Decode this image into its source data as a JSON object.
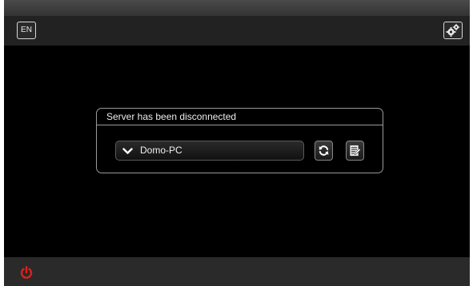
{
  "header": {
    "language_label": "EN",
    "settings_icon": "gears-icon"
  },
  "dialog": {
    "title": "Server has been disconnected",
    "server_select": {
      "value": "Domo-PC",
      "icon": "chevron-down-icon"
    },
    "refresh_icon": "refresh-icon",
    "edit_icon": "edit-icon"
  },
  "footer": {
    "power_icon": "power-icon",
    "power_color": "#e0201b"
  }
}
